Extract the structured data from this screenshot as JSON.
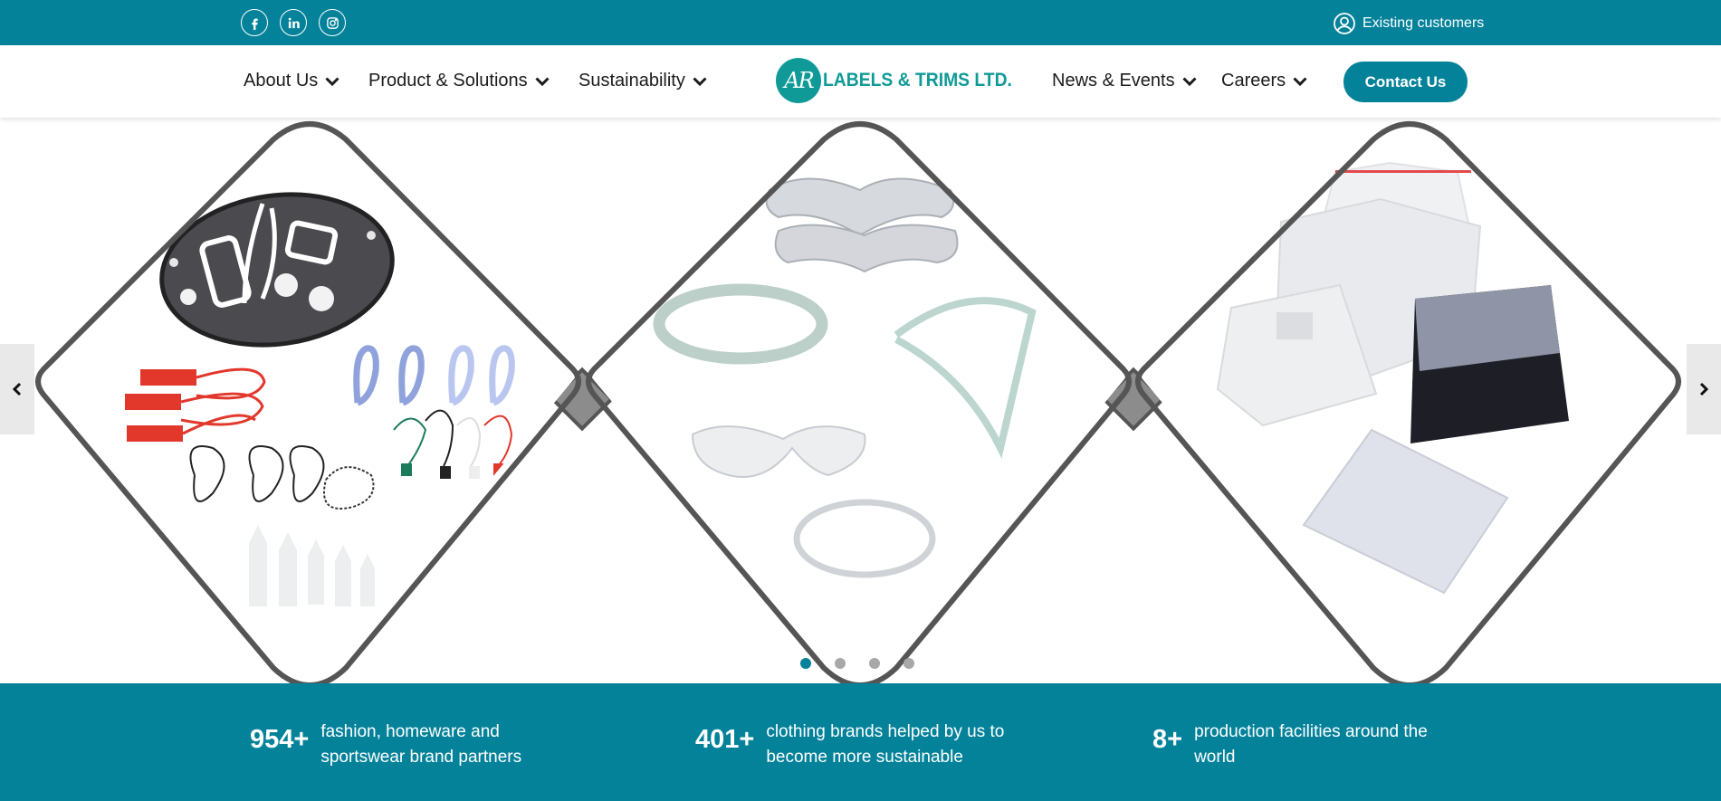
{
  "topbar": {
    "social": [
      {
        "name": "facebook-icon"
      },
      {
        "name": "linkedin-icon"
      },
      {
        "name": "instagram-icon"
      }
    ],
    "existing_customers": "Existing customers",
    "bg_color": "#04829a"
  },
  "nav": {
    "items": [
      {
        "label": "About Us"
      },
      {
        "label": "Product & Solutions"
      },
      {
        "label": "Sustainability"
      },
      {
        "label": "News & Events"
      },
      {
        "label": "Careers"
      }
    ],
    "logo": {
      "mark": "AR",
      "text": "LABELS & TRIMS LTD."
    },
    "contact": "Contact Us"
  },
  "slider": {
    "slides": [
      {
        "name": "hangers-seals-tags-collection"
      },
      {
        "name": "plastic-collar-supports"
      },
      {
        "name": "poly-bags-packaging"
      }
    ],
    "dots": 4,
    "active_dot": 0,
    "prev_icon": "chevron-left-icon",
    "next_icon": "chevron-right-icon"
  },
  "stats": [
    {
      "number": "954+",
      "line1": "fashion, homeware and",
      "line2": "sportswear brand partners"
    },
    {
      "number": "401+",
      "line1": "clothing brands helped by us to",
      "line2": "become more sustainable"
    },
    {
      "number": "8+",
      "line1": "production facilities around the",
      "line2": "world"
    }
  ],
  "colors": {
    "accent": "#04829a",
    "logo": "#0f9a97",
    "frame": "#555555"
  }
}
